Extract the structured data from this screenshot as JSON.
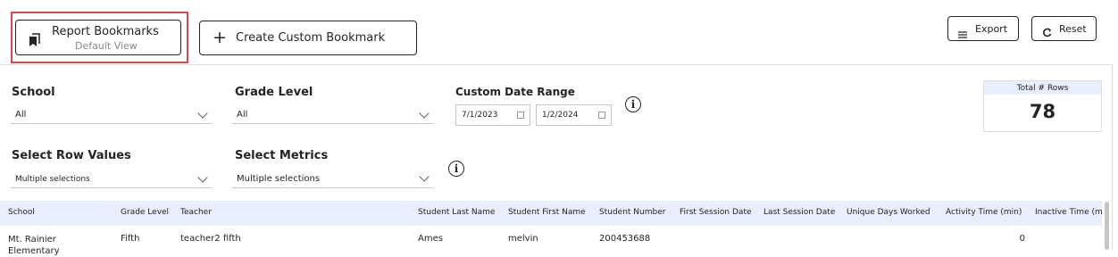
{
  "toolbar": {
    "bookmarks_title": "Report Bookmarks",
    "bookmarks_sub": "Default View",
    "create_label": "Create Custom Bookmark",
    "create_icon": "+",
    "export_label": "Export",
    "reset_label": "Reset"
  },
  "filters": {
    "school_label": "School",
    "school_value": "All",
    "grade_label": "Grade Level",
    "grade_value": "All",
    "date_label": "Custom Date Range",
    "date_start": "7/1/2023",
    "date_end": "1/2/2024",
    "rowvalues_label": "Select Row Values",
    "rowvalues_value": "Multiple selections",
    "metrics_label": "Select Metrics",
    "metrics_value": "Multiple selections"
  },
  "card": {
    "title": "Total # Rows",
    "value": "78"
  },
  "table": {
    "headers": [
      "School",
      "Grade Level",
      "Teacher",
      "Student Last Name",
      "Student First Name",
      "Student Number",
      "First Session Date",
      "Last Session Date",
      "Unique Days Worked",
      "Activity Time (min)",
      "Inactive Time (m"
    ],
    "rows": [
      [
        "Mt. Rainier Elementary",
        "Fifth",
        "teacher2 fifth",
        "Ames",
        "melvin",
        "200453688",
        "",
        "",
        "",
        "0",
        ""
      ]
    ]
  },
  "colors": {
    "highlight": "#e0474c",
    "header_bg": "#e9eefc"
  }
}
